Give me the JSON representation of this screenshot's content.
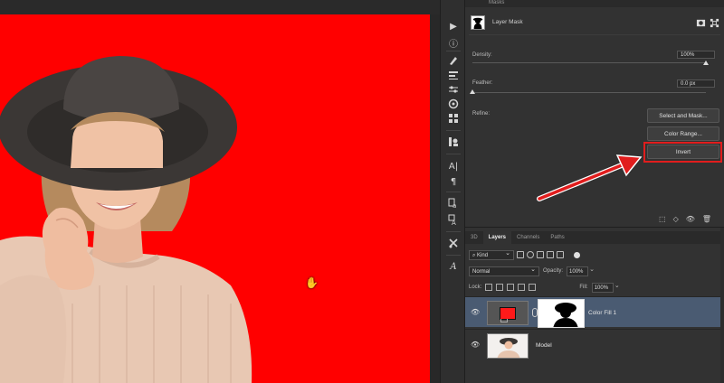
{
  "properties": {
    "header": "Masks",
    "mask_type": "Layer Mask",
    "density_label": "Density:",
    "density_value": "100%",
    "density_level": 1.0,
    "feather_label": "Feather:",
    "feather_value": "0.0 px",
    "feather_level": 0.0,
    "refine_label": "Refine:",
    "select_mask_button": "Select and Mask...",
    "color_range_button": "Color Range...",
    "invert_button": "Invert"
  },
  "layers_panel": {
    "tabs": [
      {
        "label": "3D",
        "active": false
      },
      {
        "label": "Layers",
        "active": true
      },
      {
        "label": "Channels",
        "active": false
      },
      {
        "label": "Paths",
        "active": false
      }
    ],
    "filter_kind": "Kind",
    "blend_mode": "Normal",
    "opacity_label": "Opacity:",
    "opacity_value": "100%",
    "lock_label": "Lock:",
    "fill_label": "Fill:",
    "fill_value": "100%",
    "layers": [
      {
        "name": "Color Fill 1",
        "selected": true,
        "swatch_color": "#ff1a1a"
      },
      {
        "name": "Model",
        "selected": false
      }
    ]
  },
  "colors": {
    "canvas_fill": "#ff0000",
    "highlight": "#e11d1d",
    "selected_layer": "#4a5b72"
  },
  "tools": [
    "play-icon",
    "info-icon",
    "brush-settings-icon",
    "adjustments-icon",
    "sliders-icon",
    "color-wheel-icon",
    "glyph-grid-icon",
    "clone-source-icon",
    "character-icon",
    "paragraph-icon",
    "character-style-icon",
    "paragraph-style-icon",
    "tool-presets-icon",
    "type-icon"
  ]
}
